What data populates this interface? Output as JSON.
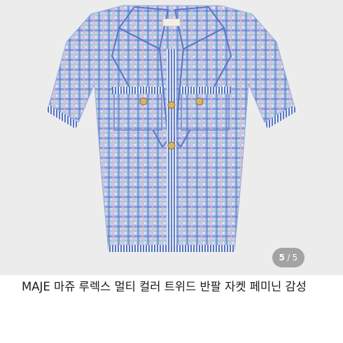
{
  "product": {
    "title": "MAJE 마쥬 루렉스 멀티 컬러 트위드 반팔 자켓 페미닌 감성",
    "image_alt": "multicolor tweed short-sleeve jacket"
  },
  "gallery": {
    "current": "5",
    "separator": "/",
    "total": "5"
  },
  "colors": {
    "image_background": "#ececec",
    "tweed_base": "#b9c6e8",
    "tweed_accent_blue": "#3d63b8",
    "tweed_accent_green": "#7fc9b4",
    "tweed_accent_pink": "#e7b3c8"
  }
}
